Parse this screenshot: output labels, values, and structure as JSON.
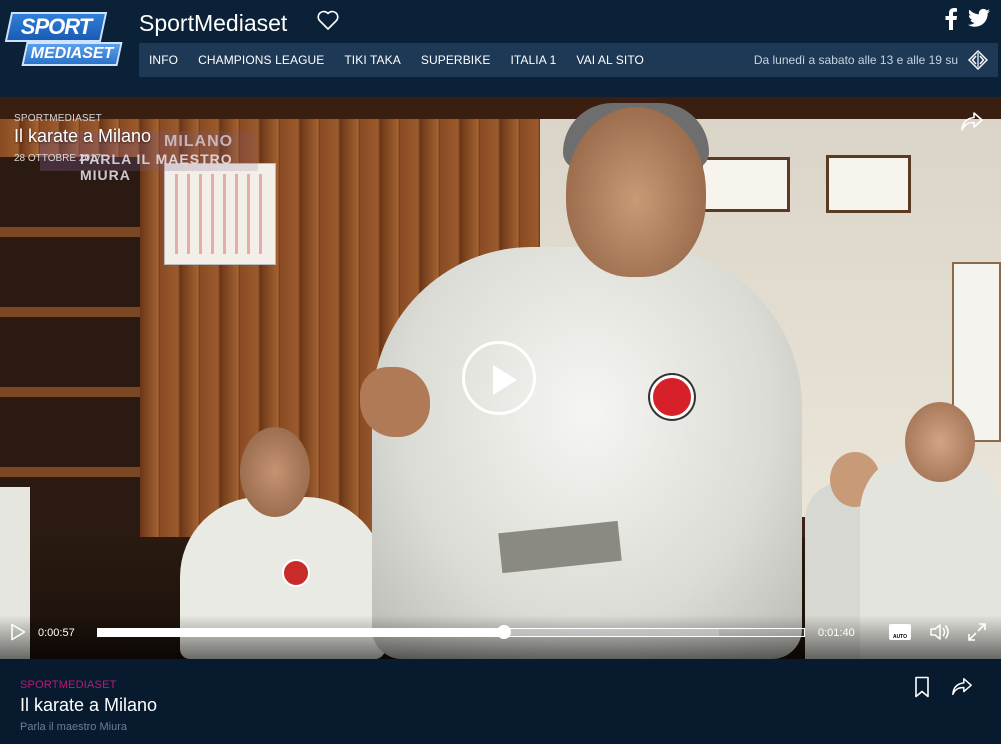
{
  "header": {
    "logo_sport": "SPORT",
    "logo_mediaset": "MEDIASET",
    "site_title": "SportMediaset",
    "favorite_icon": "heart-outline-icon",
    "social": [
      "facebook-icon",
      "twitter-icon"
    ]
  },
  "nav": {
    "items": [
      {
        "label": "INFO"
      },
      {
        "label": "CHAMPIONS LEAGUE"
      },
      {
        "label": "TIKI TAKA"
      },
      {
        "label": "SUPERBIKE"
      },
      {
        "label": "ITALIA 1"
      },
      {
        "label": "VAI AL SITO"
      }
    ],
    "schedule": "Da lunedì a sabato alle 13 e alle 19 su",
    "scroll_icon": "diamond-arrows-icon"
  },
  "video": {
    "overline": "SPORTMEDIASET",
    "title": "Il karate a Milano",
    "date": "28 OTTOBRE 2017",
    "burned_caption_line1": "MILANO",
    "burned_caption_line2": "PARLA IL MAESTRO MIURA",
    "controls": {
      "current_time": "0:00:57",
      "total_time": "0:01:40",
      "progress_fraction": 0.575,
      "buffer_fraction": 0.88,
      "quality_label": "AUTO"
    }
  },
  "info": {
    "overline": "SPORTMEDIASET",
    "title": "Il karate a Milano",
    "subtitle": "Parla il maestro Miura"
  },
  "colors": {
    "background": "#0a1e35",
    "nav_bar": "#1e3956",
    "accent_magenta": "#c0177a"
  }
}
